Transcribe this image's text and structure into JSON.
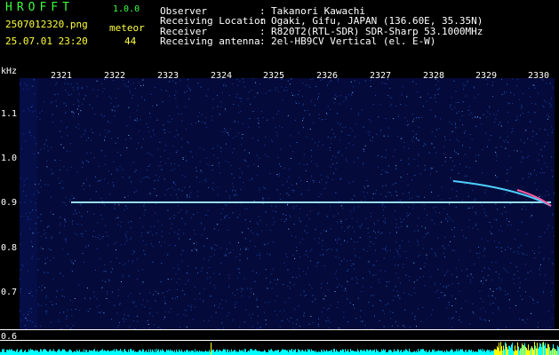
{
  "header": {
    "app_name": "HROFFT",
    "version": "1.0.0",
    "filename": "2507012320.png",
    "meteor_label": "meteor",
    "meteor_count": "44",
    "datetime": "25.07.01 23:20",
    "fields": [
      {
        "label": "Observer",
        "value": "Takanori Kawachi"
      },
      {
        "label": "Receiving Location",
        "value": "Ogaki, Gifu, JAPAN (136.60E, 35.35N)"
      },
      {
        "label": "Receiver",
        "value": "R820T2(RTL-SDR) SDR-Sharp 53.1000MHz"
      },
      {
        "label": "Receiving antenna",
        "value": "2el-HB9CV Vertical (el. E-W)"
      }
    ]
  },
  "axes": {
    "y_unit": "kHz",
    "x_ticks": [
      "2321",
      "2322",
      "2323",
      "2324",
      "2325",
      "2326",
      "2327",
      "2328",
      "2329",
      "2330"
    ],
    "y_ticks": [
      "1.1",
      "1.0",
      "0.9",
      "0.8",
      "0.7",
      "0.6"
    ]
  },
  "colors": {
    "background": "#040b3a",
    "signal": "#7fd8ff",
    "meteor": "#ff5aa0",
    "level": "#00ffff",
    "peak": "#ffff00"
  }
}
